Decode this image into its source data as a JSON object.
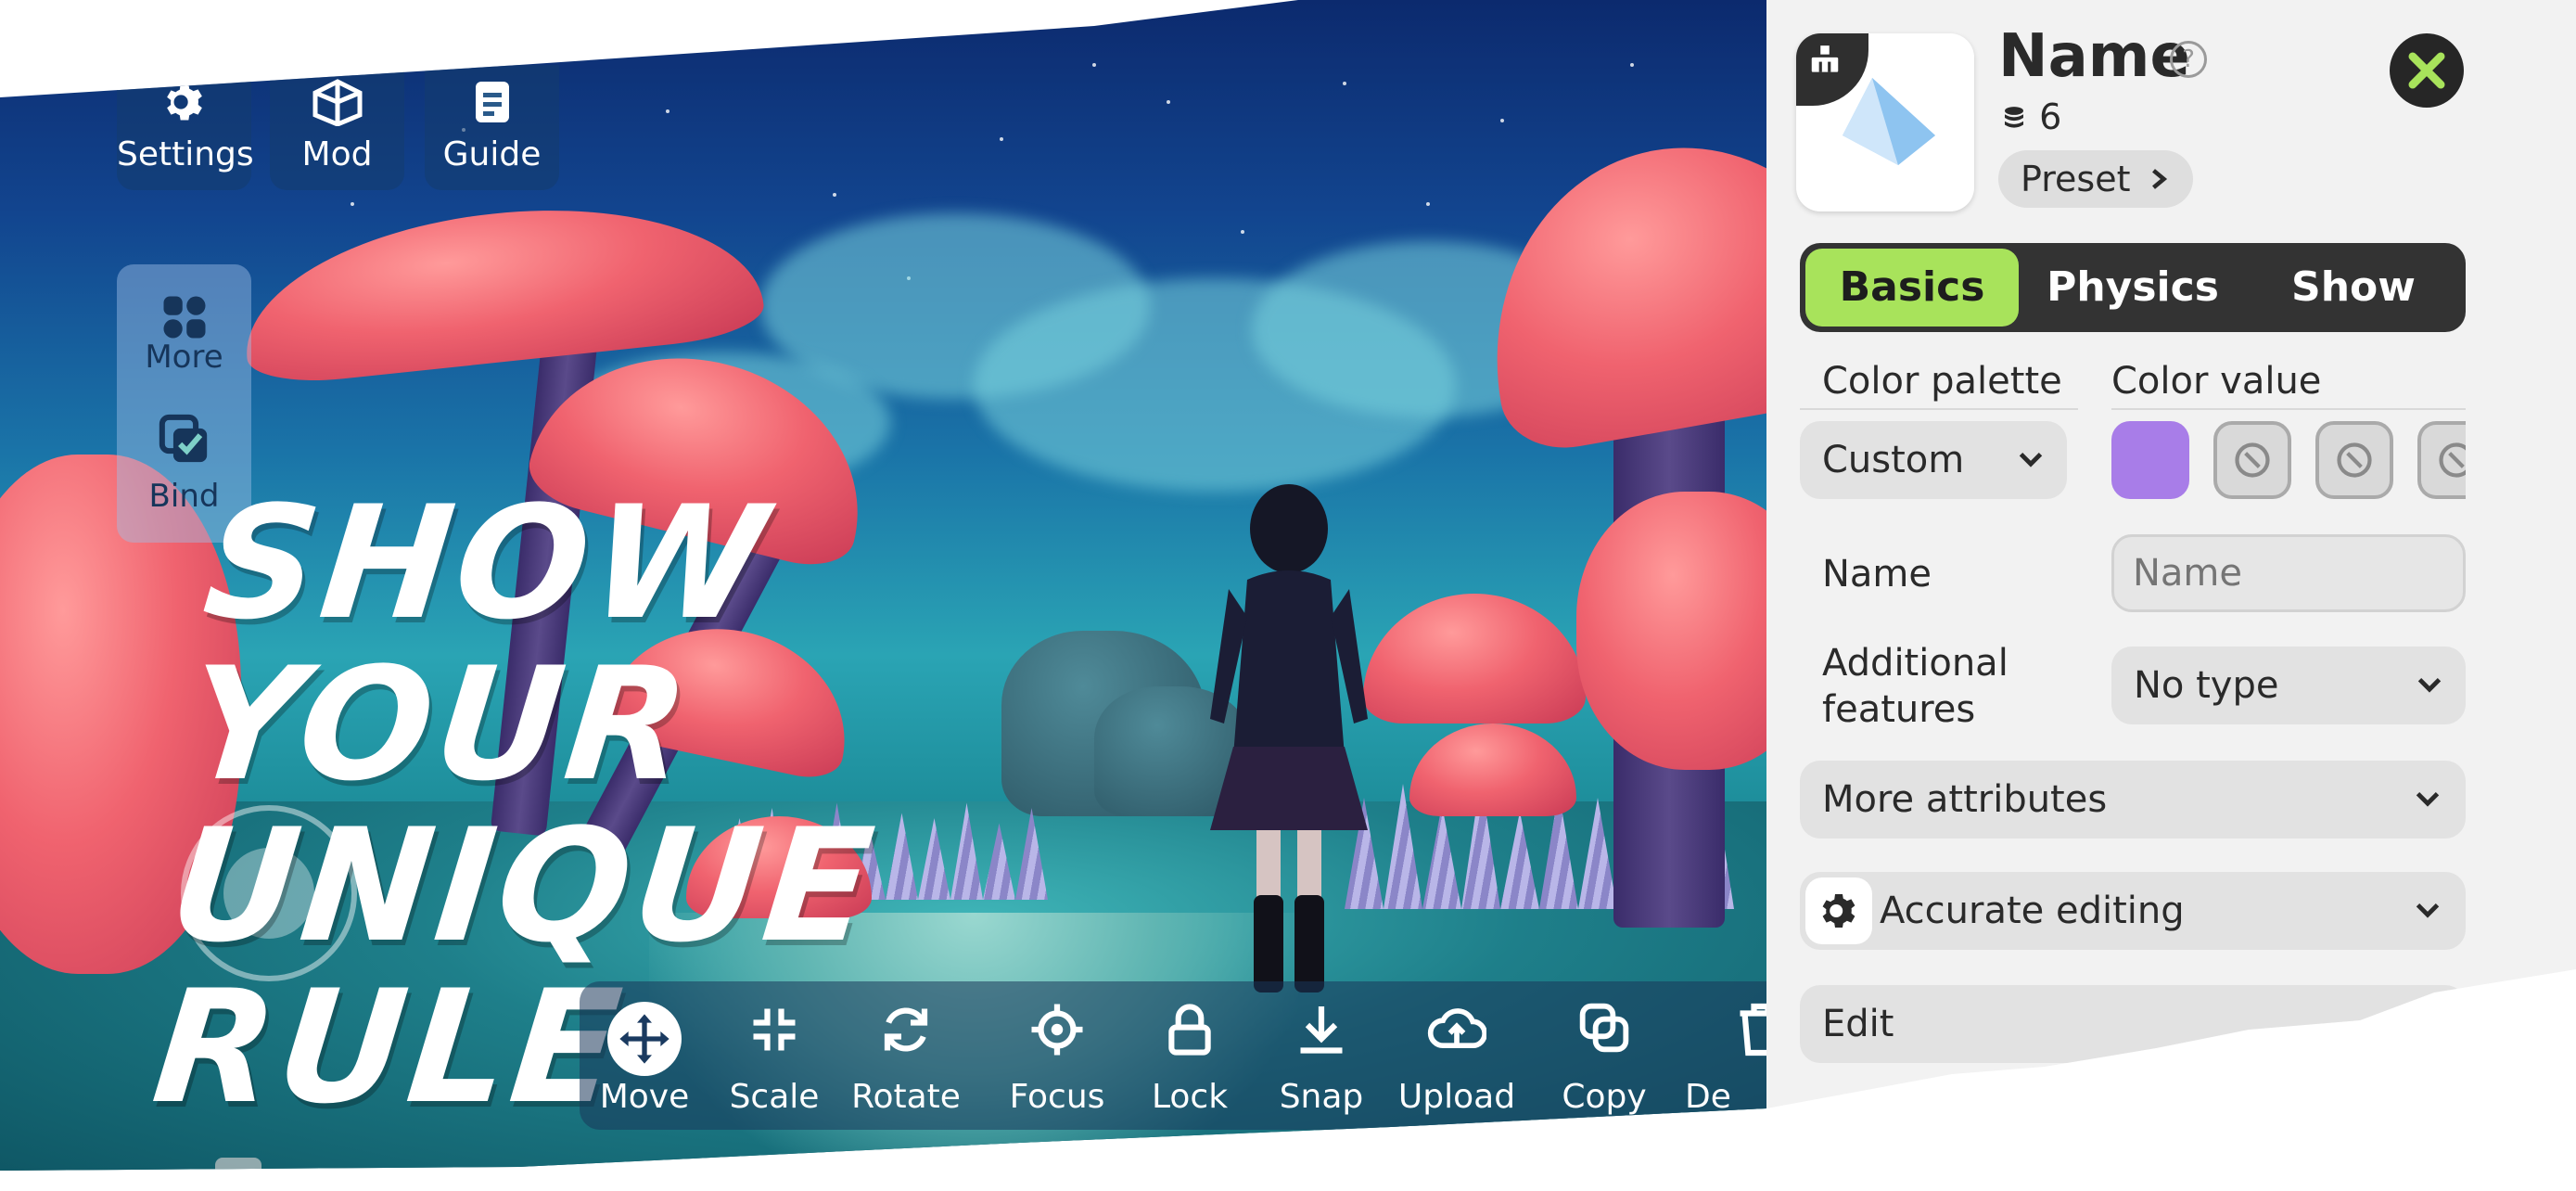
{
  "top_buttons": [
    {
      "label": "Settings",
      "icon": "gear-icon"
    },
    {
      "label": "Mod",
      "icon": "cube-icon"
    },
    {
      "label": "Guide",
      "icon": "book-icon"
    }
  ],
  "side_buttons": [
    {
      "label": "More",
      "icon": "grid-icon"
    },
    {
      "label": "Bind",
      "icon": "bind-icon"
    }
  ],
  "slogan": [
    "SHOW",
    "YOUR",
    "UNIQUE",
    "RULE"
  ],
  "toolbar": [
    {
      "label": "Move",
      "icon": "move-icon",
      "active": true
    },
    {
      "label": "Scale",
      "icon": "scale-icon"
    },
    {
      "label": "Rotate",
      "icon": "rotate-icon"
    },
    {
      "label": "Focus",
      "icon": "focus-icon"
    },
    {
      "label": "Lock",
      "icon": "lock-icon"
    },
    {
      "label": "Snap",
      "icon": "snap-icon"
    },
    {
      "label": "Upload",
      "icon": "upload-icon"
    },
    {
      "label": "Copy",
      "icon": "copy-icon"
    },
    {
      "label": "De",
      "icon": "delete-icon"
    }
  ],
  "panel": {
    "title": "Name",
    "cost": "6",
    "preset_label": "Preset",
    "tabs": [
      "Basics",
      "Physics",
      "Show"
    ],
    "active_tab": "Basics",
    "color_palette_label": "Color palette",
    "color_value_label": "Color value",
    "palette_value": "Custom",
    "selected_color": "#a87de8",
    "name_label": "Name",
    "name_placeholder": "Name",
    "additional_label": "Additional features",
    "additional_value": "No type",
    "more_attributes": "More attributes",
    "accurate_editing": "Accurate editing",
    "edit": "Edit"
  },
  "colors": {
    "accent_green": "#a8e35b",
    "panel_bg": "#f2f2f2",
    "tab_bg": "#333333"
  }
}
